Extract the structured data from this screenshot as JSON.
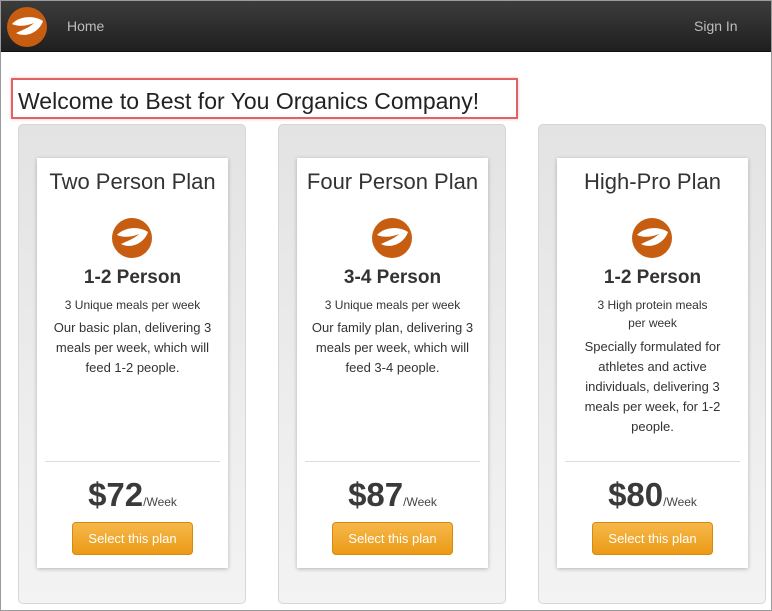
{
  "nav": {
    "logo_icon": "leaf-logo-icon",
    "home_label": "Home",
    "signin_label": "Sign In"
  },
  "welcome": {
    "title": "Welcome to Best for You Organics Company!"
  },
  "colors": {
    "brand_orange": "#c65d11",
    "button_orange": "#eb9a16",
    "highlight_red": "#e06262",
    "navbar_dark": "#2b2b2b"
  },
  "plans": [
    {
      "name": "Two Person Plan",
      "icon": "leaf-logo-icon",
      "persons": "1-2 Person",
      "meals": "3 Unique meals per week",
      "description": "Our basic plan, delivering 3 meals per week, which will feed 1-2 people.",
      "price": "$72",
      "per": "/Week",
      "button_label": "Select this plan"
    },
    {
      "name": "Four Person Plan",
      "icon": "leaf-logo-icon",
      "persons": "3-4 Person",
      "meals": "3 Unique meals per week",
      "description": "Our family plan, delivering 3 meals per week, which will feed 3-4 people.",
      "price": "$87",
      "per": "/Week",
      "button_label": "Select this plan"
    },
    {
      "name": "High-Pro Plan",
      "icon": "leaf-logo-icon",
      "persons": "1-2 Person",
      "meals": "3 High protein meals per week",
      "description": "Specially formulated for athletes and active individuals, delivering 3 meals per week, for 1-2 people.",
      "price": "$80",
      "per": "/Week",
      "button_label": "Select this plan"
    }
  ]
}
